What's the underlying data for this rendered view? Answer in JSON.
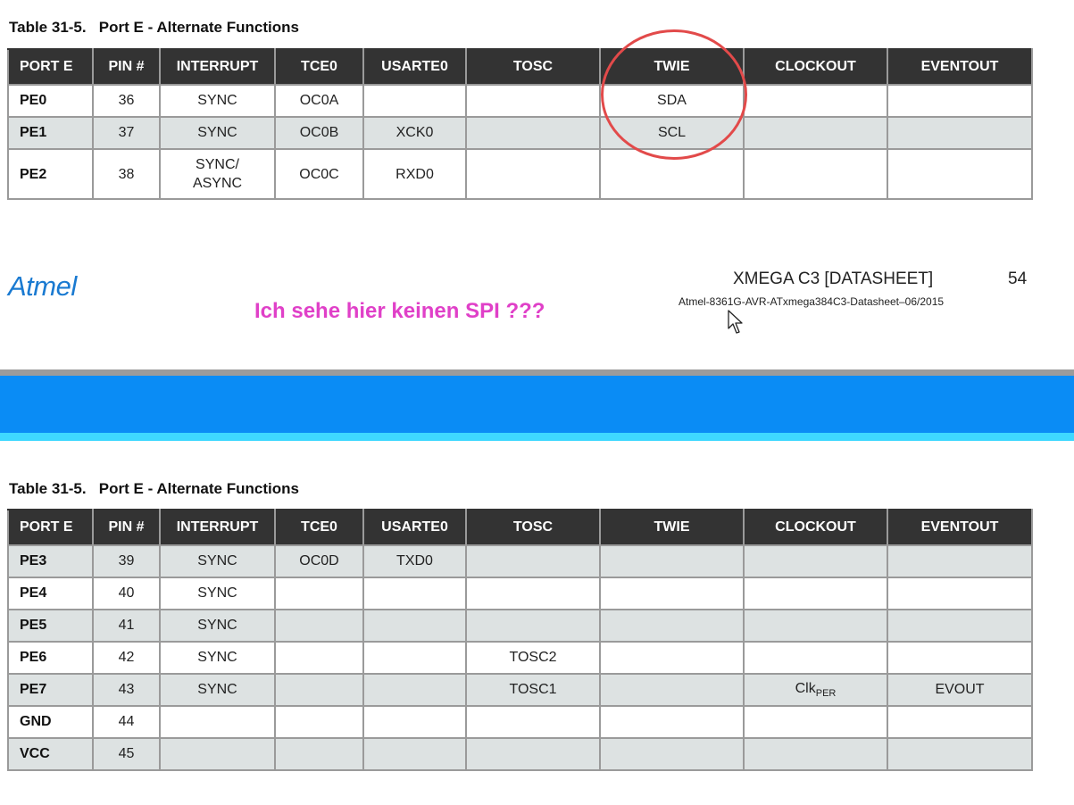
{
  "table_caption": "Table 31-5.   Port E - Alternate Functions",
  "headers": [
    "PORT E",
    "PIN #",
    "INTERRUPT",
    "TCE0",
    "USARTE0",
    "TOSC",
    "TWIE",
    "CLOCKOUT",
    "EVENTOUT"
  ],
  "top_rows": [
    {
      "port": "PE0",
      "pin": "36",
      "interrupt": "SYNC",
      "tce0": "OC0A",
      "usarte0": "",
      "tosc": "",
      "twie": "SDA",
      "clockout": "",
      "eventout": ""
    },
    {
      "port": "PE1",
      "pin": "37",
      "interrupt": "SYNC",
      "tce0": "OC0B",
      "usarte0": "XCK0",
      "tosc": "",
      "twie": "SCL",
      "clockout": "",
      "eventout": ""
    },
    {
      "port": "PE2",
      "pin": "38",
      "interrupt_line1": "SYNC/",
      "interrupt_line2": "ASYNC",
      "tce0": "OC0C",
      "usarte0": "RXD0",
      "tosc": "",
      "twie": "",
      "clockout": "",
      "eventout": ""
    }
  ],
  "bottom_rows": [
    {
      "port": "PE3",
      "pin": "39",
      "interrupt": "SYNC",
      "tce0": "OC0D",
      "usarte0": "TXD0",
      "tosc": "",
      "twie": "",
      "clockout": "",
      "eventout": ""
    },
    {
      "port": "PE4",
      "pin": "40",
      "interrupt": "SYNC",
      "tce0": "",
      "usarte0": "",
      "tosc": "",
      "twie": "",
      "clockout": "",
      "eventout": ""
    },
    {
      "port": "PE5",
      "pin": "41",
      "interrupt": "SYNC",
      "tce0": "",
      "usarte0": "",
      "tosc": "",
      "twie": "",
      "clockout": "",
      "eventout": ""
    },
    {
      "port": "PE6",
      "pin": "42",
      "interrupt": "SYNC",
      "tce0": "",
      "usarte0": "",
      "tosc": "TOSC2",
      "twie": "",
      "clockout": "",
      "eventout": ""
    },
    {
      "port": "PE7",
      "pin": "43",
      "interrupt": "SYNC",
      "tce0": "",
      "usarte0": "",
      "tosc": "TOSC1",
      "twie": "",
      "clockout_main": "Clk",
      "clockout_sub": "PER",
      "eventout": "EVOUT"
    },
    {
      "port": "GND",
      "pin": "44",
      "interrupt": "",
      "tce0": "",
      "usarte0": "",
      "tosc": "",
      "twie": "",
      "clockout": "",
      "eventout": ""
    },
    {
      "port": "VCC",
      "pin": "45",
      "interrupt": "",
      "tce0": "",
      "usarte0": "",
      "tosc": "",
      "twie": "",
      "clockout": "",
      "eventout": ""
    }
  ],
  "footer": {
    "logo": "Atmel",
    "doc_title": "XMEGA C3 [DATASHEET]",
    "page_number": "54",
    "doc_id": "Atmel-8361G-AVR-ATxmega384C3-Datasheet–06/2015"
  },
  "annotation": "Ich sehe hier keinen SPI ???",
  "colors": {
    "header_bg": "#333333",
    "row_alt_bg": "#dde2e2",
    "highlight_circle": "#e24a4a",
    "annotation_text": "#e040c8",
    "logo": "#1a7ad1",
    "band_blue": "#0a8cf5",
    "band_cyan": "#3ed8ff",
    "band_gray": "#9b9b9b"
  },
  "icons": {
    "cursor": "mouse-pointer-icon"
  }
}
